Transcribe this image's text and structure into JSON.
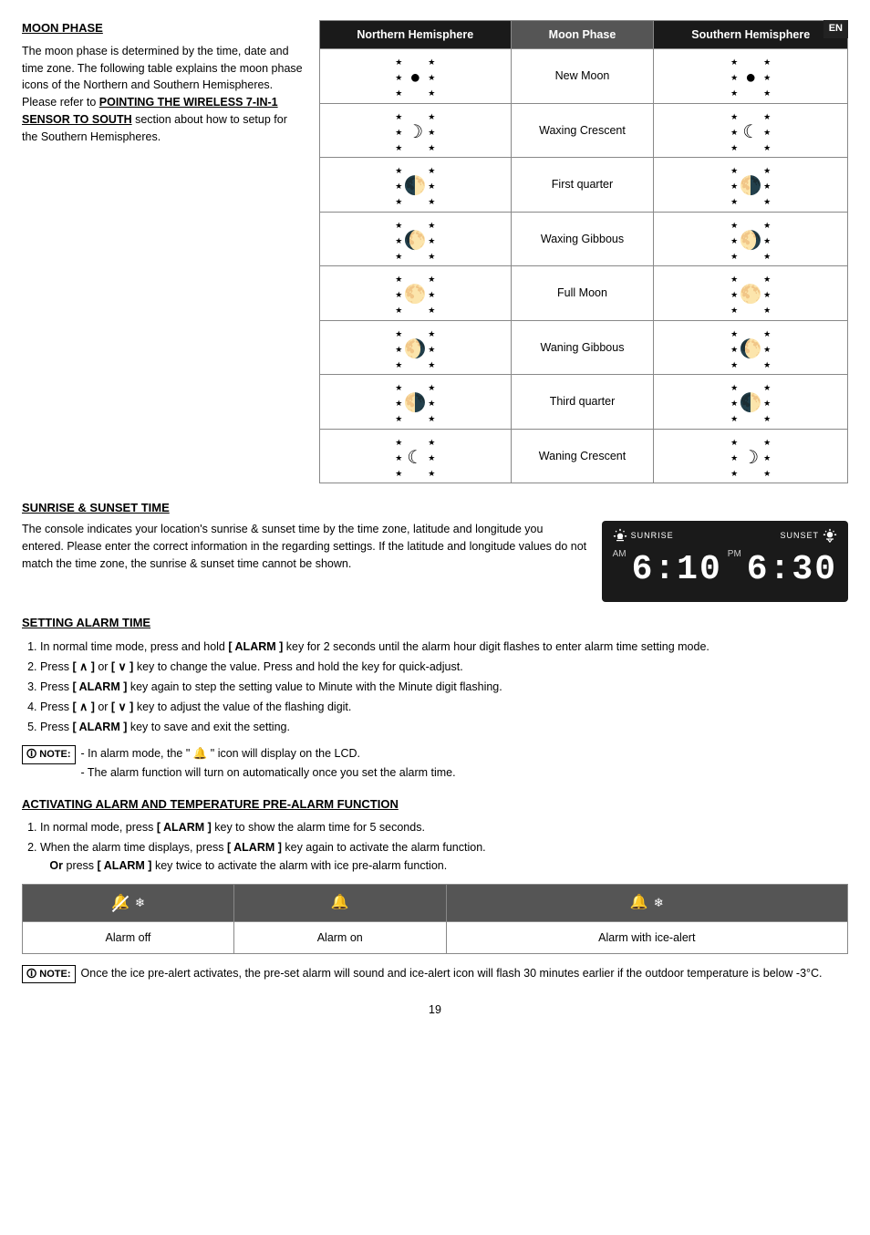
{
  "page": {
    "lang_badge": "EN",
    "page_number": "19"
  },
  "moon_phase_section": {
    "title": "MOON PHASE",
    "description": "The moon phase is determined by the time, date and time zone. The following table explains the moon phase icons of the Northern and Southern Hemispheres. Please refer to ",
    "bold_link": "POINTING THE WIRELESS 7-IN-1 SENSOR TO SOUTH",
    "description2": " section about how to setup for the Southern Hemispheres.",
    "table": {
      "col1": "Northern Hemisphere",
      "col2": "Moon Phase",
      "col3": "Southern Hemisphere",
      "rows": [
        {
          "name": "New Moon"
        },
        {
          "name": "Waxing Crescent"
        },
        {
          "name": "First quarter"
        },
        {
          "name": "Waxing Gibbous"
        },
        {
          "name": "Full Moon"
        },
        {
          "name": "Waning Gibbous"
        },
        {
          "name": "Third quarter"
        },
        {
          "name": "Waning Crescent"
        }
      ]
    }
  },
  "sunrise_section": {
    "title": "SUNRISE & SUNSET TIME",
    "description": "The console indicates your location's sunrise & sunset time by the time zone, latitude and longitude you entered. Please enter the correct information in the regarding settings. If the latitude and longitude values do not match the time zone, the sunrise & sunset time cannot be shown.",
    "display": {
      "sunrise_label": "SUNRISE",
      "sunset_label": "SUNSET",
      "am_label": "AM",
      "pm_label": "PM",
      "sunrise_time": "6:10",
      "sunset_time": "6:30"
    }
  },
  "setting_alarm_section": {
    "title": "SETTING ALARM TIME",
    "steps": [
      "In normal time mode, press and hold [ ALARM ] key for 2 seconds until the alarm hour digit flashes to enter alarm time setting mode.",
      "Press [ ∧ ] or [ ∨ ] key to change the value. Press and hold the key for quick-adjust.",
      "Press [ ALARM ] key again to step the setting value to Minute with the Minute digit flashing.",
      "Press [ ∧ ] or [ ∨ ]  key to adjust the value of the flashing digit.",
      "Press [ ALARM ] key to save and exit the setting."
    ]
  },
  "note1": {
    "icon": "i",
    "label": "NOTE:",
    "lines": [
      "- In alarm mode, the \" 🔔 \" icon will display on the LCD.",
      "- The alarm function will turn on automatically once you set the alarm time."
    ]
  },
  "activating_section": {
    "title": "ACTIVATING ALARM AND TEMPERATURE PRE-ALARM FUNCTION",
    "steps": [
      "In normal mode, press [ ALARM ] key to show the alarm time for 5 seconds.",
      "When the alarm time displays, press [ ALARM ] key again to activate the alarm function. Or press [ ALARM ] key twice to activate the alarm with ice pre-alarm function."
    ]
  },
  "alarm_states": {
    "off_label": "Alarm off",
    "on_label": "Alarm on",
    "ice_label": "Alarm with ice-alert"
  },
  "note2": {
    "icon": "i",
    "label": "NOTE:",
    "text": "Once the ice pre-alert activates, the pre-set alarm will sound and ice-alert icon will flash 30 minutes earlier if the outdoor temperature is below -3°C."
  }
}
